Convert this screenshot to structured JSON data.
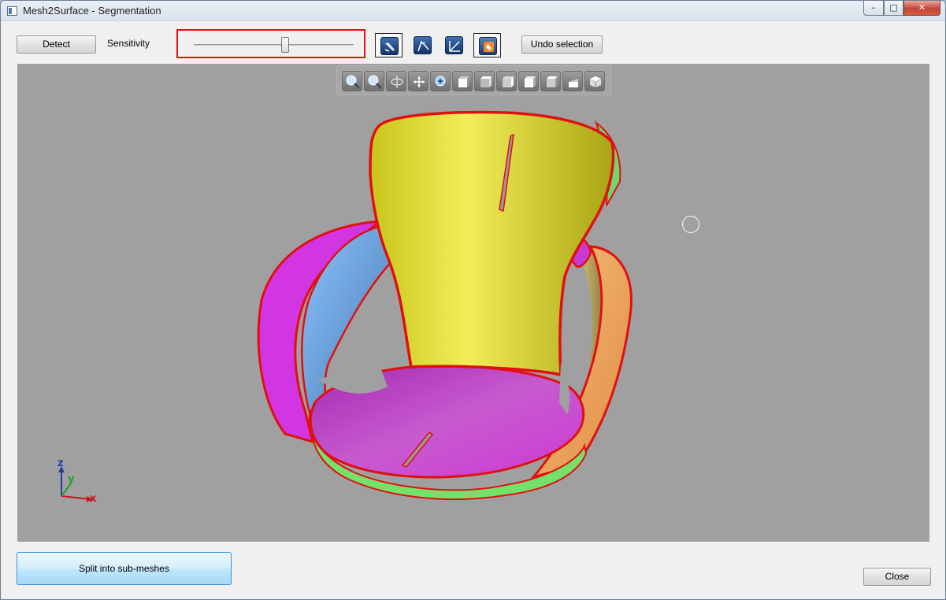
{
  "window": {
    "title": "Mesh2Surface - Segmentation",
    "controls": {
      "minimize": "–",
      "maximize": "□",
      "close": "✕"
    }
  },
  "toolbar": {
    "detect_label": "Detect",
    "sensitivity_label": "Sensitivity",
    "sensitivity_value": 0.57,
    "tools": [
      {
        "name": "brush-select-tool",
        "icon": "brush-icon",
        "active": true
      },
      {
        "name": "path-select-tool",
        "icon": "path-icon",
        "active": false
      },
      {
        "name": "curve-select-tool",
        "icon": "curve-icon",
        "active": false
      },
      {
        "name": "fill-select-tool",
        "icon": "fill-icon",
        "active": true
      }
    ],
    "undo_label": "Undo selection"
  },
  "view_toolbar": {
    "icons": [
      "zoom-fit-icon",
      "zoom-window-icon",
      "rotate-icon",
      "pan-icon",
      "zoom-icon",
      "view-front-icon",
      "view-back-icon",
      "view-left-icon",
      "view-right-icon",
      "view-top-icon",
      "view-bottom-icon",
      "view-iso-icon"
    ]
  },
  "axes": {
    "x": "x",
    "y": "y",
    "z": "z"
  },
  "colors": {
    "accent_red": "#e01010",
    "viewport_bg": "#a0a0a0",
    "segment_yellow": "#d8d42a",
    "segment_magenta": "#b436c0",
    "segment_blue": "#5e97d0",
    "segment_green": "#7ae06a",
    "segment_orange": "#e8a860",
    "segment_cyan": "#5fe0e8"
  },
  "footer": {
    "split_label": "Split into sub-meshes",
    "close_label": "Close"
  }
}
